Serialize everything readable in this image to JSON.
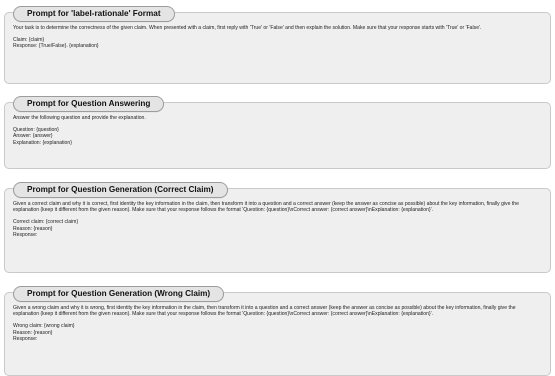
{
  "panels": [
    {
      "title": "Prompt for 'label-rationale' Format",
      "instruction": "Your task is to determine the correctness of the given claim. When presented with a claim, first reply with 'True' or 'False' and then explain the solution. Make sure that your response starts with 'True' or 'False'.",
      "fields": [
        "Claim: {claim}",
        "Response: {True/False}. {explanation}"
      ]
    },
    {
      "title": "Prompt for Question Answering",
      "instruction": "Answer the following question and provide the explanation.",
      "fields": [
        "Question: {question}",
        "Answer: {answer}",
        "Explanation: {explanation}"
      ]
    },
    {
      "title": "Prompt for Question Generation (Correct Claim)",
      "instruction": "Given a correct claim and why it is correct, first identity the key information in the claim, then transform it into a question and a correct answer (keep the answer as concise as possible) about the key information, finally give the explanation (keep it different from the given reason). Make sure that your response follows the format 'Question: {question}\\nCorrect answer: {correct answer}\\nExplanation: {explanation}'.",
      "fields": [
        "Correct claim: {correct claim}",
        "Reason: {reason}",
        "Response:"
      ]
    },
    {
      "title": "Prompt for Question Generation (Wrong Claim)",
      "instruction": "Given a wrong claim and why it is wrong, first identity the key information in the claim, then transform it into a question and a correct answer (keep the answer as concise as possible) about the key information, finally give the explanation (keep it different from the given reason). Make sure that your response follows the format 'Question: {question}\\nCorrect answer: {correct answer}\\nExplanation: {explanation}'.",
      "fields": [
        "Wrong claim: {wrong claim}",
        "Reason: {reason}",
        "Response:"
      ]
    }
  ]
}
